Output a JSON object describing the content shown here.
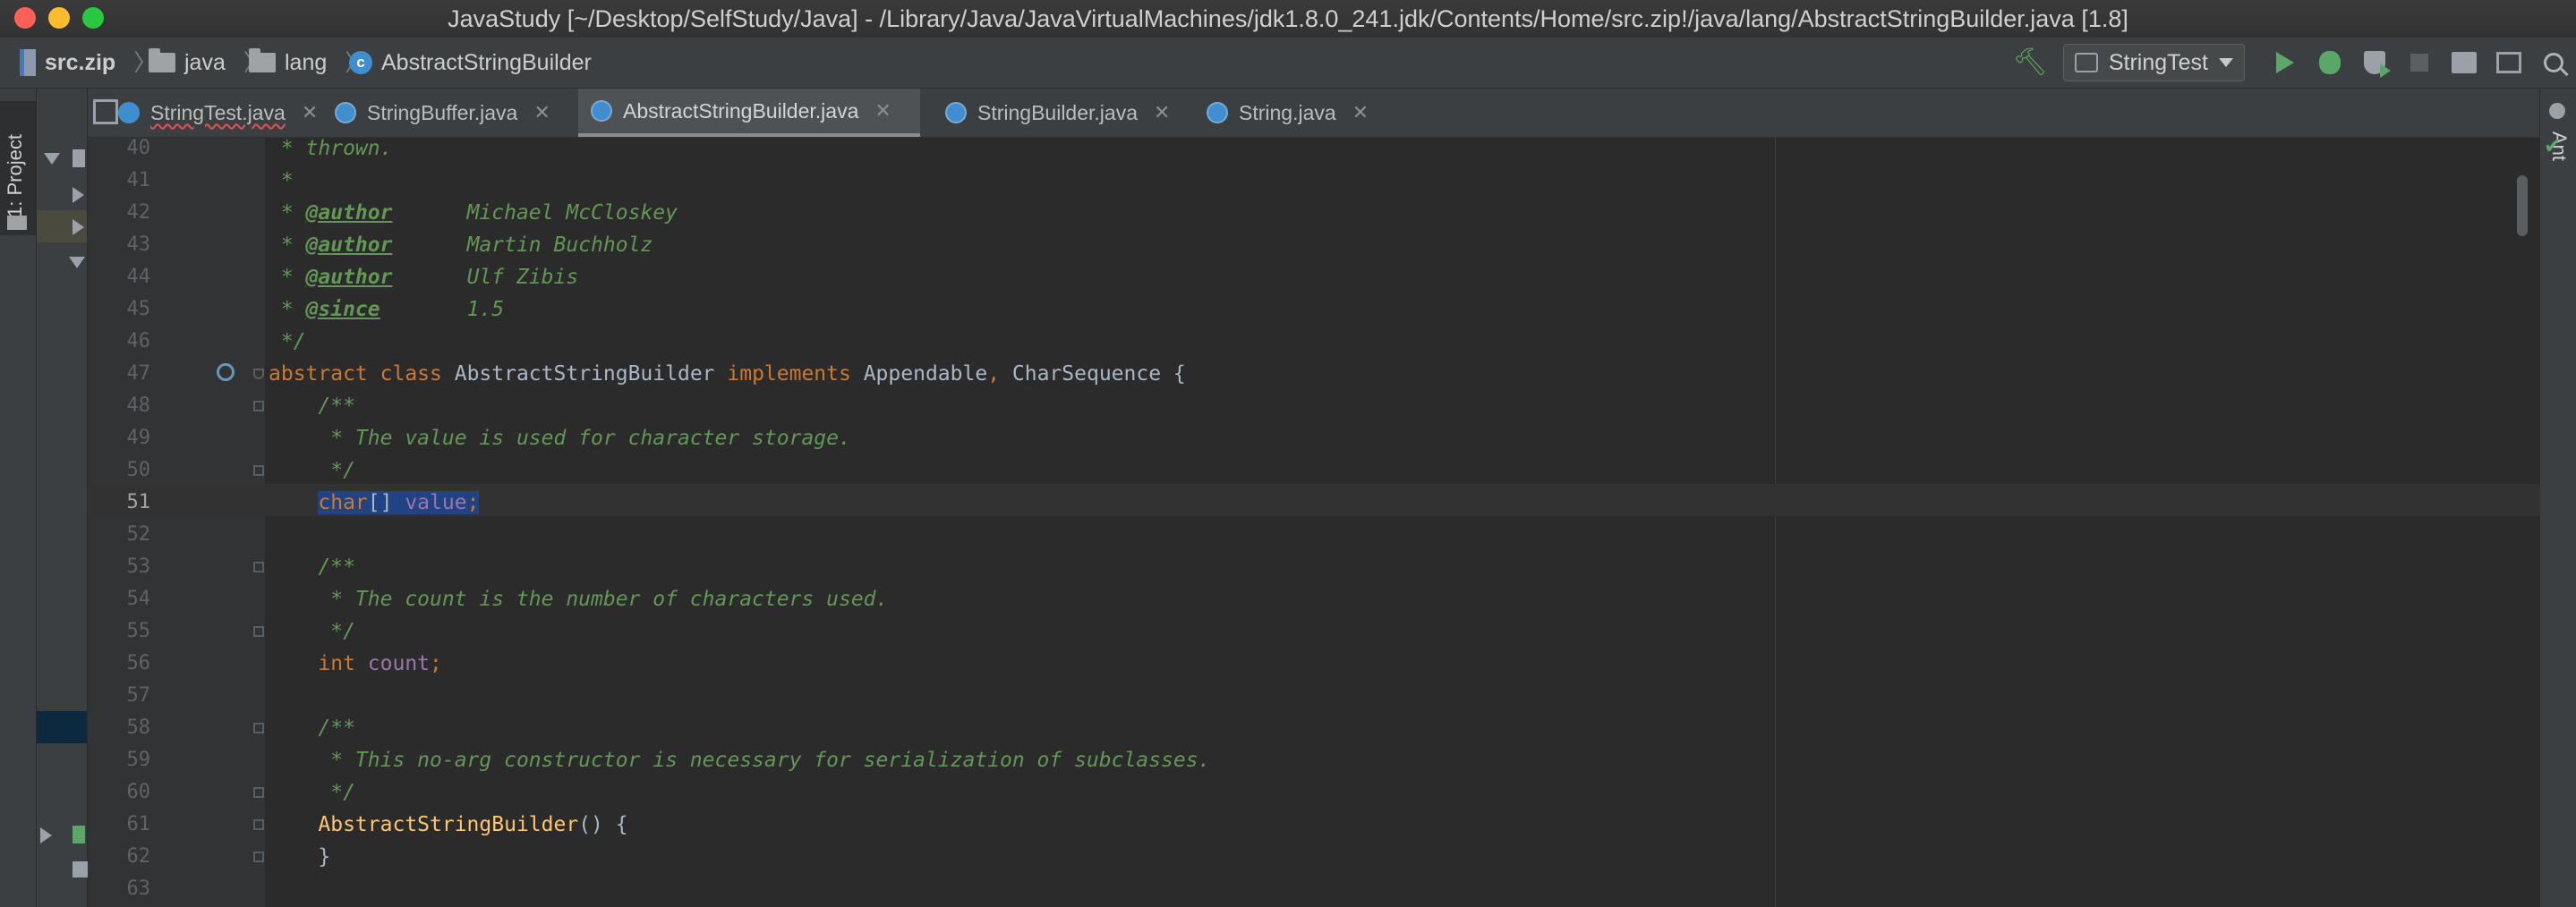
{
  "window": {
    "title": "JavaStudy [~/Desktop/SelfStudy/Java] - /Library/Java/JavaVirtualMachines/jdk1.8.0_241.jdk/Contents/Home/src.zip!/java/lang/AbstractStringBuilder.java [1.8]"
  },
  "breadcrumb": {
    "items": [
      "src.zip",
      "java",
      "lang",
      "AbstractStringBuilder"
    ]
  },
  "toolbar": {
    "run_config": "StringTest"
  },
  "tool_windows": {
    "left": "1: Project",
    "right": "Ant"
  },
  "tabs": [
    {
      "label": "StringTest.java",
      "active": false
    },
    {
      "label": "StringBuffer.java",
      "active": false
    },
    {
      "label": "AbstractStringBuilder.java",
      "active": true
    },
    {
      "label": "StringBuilder.java",
      "active": false
    },
    {
      "label": "String.java",
      "active": false
    }
  ],
  "editor": {
    "current_line": "51",
    "line_numbers": [
      "40",
      "41",
      "42",
      "43",
      "44",
      "45",
      "46",
      "47",
      "48",
      "49",
      "50",
      "51",
      "52",
      "53",
      "54",
      "55",
      "56",
      "57",
      "58",
      "59",
      "60",
      "61",
      "62",
      "63"
    ],
    "code": {
      "l40": " * thrown.",
      "l41": " *",
      "l42_star": " * ",
      "l42_tag": "@author",
      "l42_val": "      Michael McCloskey",
      "l43_star": " * ",
      "l43_tag": "@author",
      "l43_val": "      Martin Buchholz",
      "l44_star": " * ",
      "l44_tag": "@author",
      "l44_val": "      Ulf Zibis",
      "l45_star": " * ",
      "l45_tag": "@since",
      "l45_val": "       1.5",
      "l46": " */",
      "l47_kw1": "abstract class",
      "l47_name": " AbstractStringBuilder ",
      "l47_kw2": "implements",
      "l47_rest1": " Appendable",
      "l47_comma": ",",
      "l47_rest2": " CharSequence {",
      "l48": "    /**",
      "l49": "     * The value is used for character storage.",
      "l50": "     */",
      "l51_indent": "    ",
      "l51_kw": "char",
      "l51_mid": "[] ",
      "l51_fld": "value",
      "l51_end": ";",
      "l53": "    /**",
      "l54": "     * The count is the number of characters used.",
      "l55": "     */",
      "l56_indent": "    ",
      "l56_kw": "int",
      "l56_sp": " ",
      "l56_fld": "count",
      "l56_end": ";",
      "l58": "    /**",
      "l59": "     * This no-arg constructor is necessary for serialization of subclasses.",
      "l60": "     */",
      "l61_indent": "    ",
      "l61_fn": "AbstractStringBuilder",
      "l61_end": "() {",
      "l62": "    }"
    }
  }
}
